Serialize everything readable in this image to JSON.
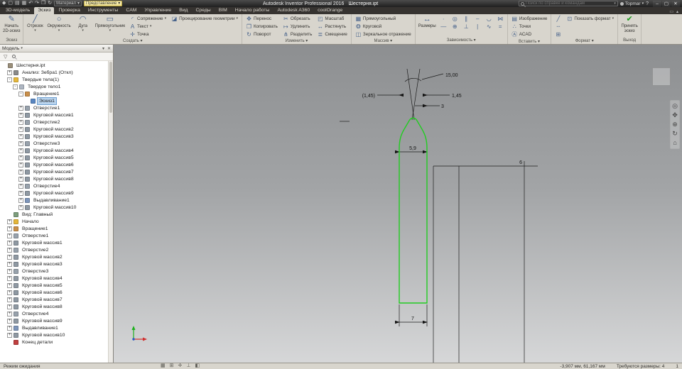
{
  "titlebar": {
    "app_title": "Autodesk Inventor Professional 2016",
    "doc_title": "Шестерня.ipt",
    "search_placeholder": "Поиск по справке и командам",
    "user": "Topmar",
    "material_combo": "Материал",
    "appearance_combo": "Представление",
    "help": "?",
    "win_min": "–",
    "win_max": "▢",
    "win_close": "✕",
    "qat": [
      {
        "name": "app-menu",
        "glyph": "◆"
      },
      {
        "name": "new-file",
        "glyph": "▢"
      },
      {
        "name": "open-file",
        "glyph": "▤"
      },
      {
        "name": "save",
        "glyph": "▦"
      },
      {
        "name": "undo",
        "glyph": "↶"
      },
      {
        "name": "redo",
        "glyph": "↷"
      },
      {
        "name": "print",
        "glyph": "❒"
      },
      {
        "name": "update",
        "glyph": "↻"
      }
    ]
  },
  "tabs": {
    "items": [
      "3D-модель",
      "Эскиз",
      "Проверка",
      "Инструменты",
      "CAM",
      "Управление",
      "Вид",
      "Среды",
      "BIM",
      "Начало работы",
      "Autodesk A360",
      "coolOrange"
    ],
    "active": "Эскиз",
    "right_icons": [
      {
        "name": "ribbon-display-toggle",
        "glyph": "▭"
      },
      {
        "name": "ribbon-collapse",
        "glyph": "▴"
      }
    ]
  },
  "ribbon": {
    "groups": [
      {
        "label": "Эскиз",
        "big": [
          {
            "name": "start-2d-sketch",
            "glyph": "✎",
            "label": "Начать\n2D-эскиз"
          }
        ]
      },
      {
        "label": "Создать",
        "menu_arrow": true,
        "big": [
          {
            "name": "line",
            "glyph": "╱",
            "label": "Отрезок",
            "dd": true
          },
          {
            "name": "circle",
            "glyph": "○",
            "label": "Окружность",
            "dd": true
          },
          {
            "name": "arc",
            "glyph": "◠",
            "label": "Дуга",
            "dd": true
          },
          {
            "name": "rectangle",
            "glyph": "▭",
            "label": "Прямоугольник",
            "dd": true
          }
        ],
        "cols": [
          [
            {
              "name": "fillet",
              "glyph": "◜",
              "label": "Сопряжение",
              "dd": true
            },
            {
              "name": "text",
              "glyph": "A",
              "label": "Текст",
              "dd": true
            },
            {
              "name": "point",
              "glyph": "✛",
              "label": "Точка"
            }
          ],
          [
            {
              "name": "project-geometry",
              "glyph": "◪",
              "label": "Проецирование геометрии",
              "dd": true
            }
          ]
        ]
      },
      {
        "label": "Изменить",
        "menu_arrow": true,
        "cols": [
          [
            {
              "name": "move",
              "glyph": "✥",
              "label": "Перенос"
            },
            {
              "name": "copy",
              "glyph": "❐",
              "label": "Копировать"
            },
            {
              "name": "rotate",
              "glyph": "↻",
              "label": "Поворот"
            }
          ],
          [
            {
              "name": "trim",
              "glyph": "✂",
              "label": "Обрезать"
            },
            {
              "name": "extend",
              "glyph": "↦",
              "label": "Удлинить"
            },
            {
              "name": "split",
              "glyph": "⋔",
              "label": "Разделить"
            }
          ],
          [
            {
              "name": "scale",
              "glyph": "◰",
              "label": "Масштаб"
            },
            {
              "name": "stretch",
              "glyph": "↔",
              "label": "Растянуть"
            },
            {
              "name": "offset",
              "glyph": "≣",
              "label": "Смещение"
            }
          ]
        ]
      },
      {
        "label": "Массив",
        "menu_arrow": true,
        "cols": [
          [
            {
              "name": "rectangular-pattern",
              "glyph": "▦",
              "label": "Прямоугольный"
            },
            {
              "name": "circular-pattern",
              "glyph": "❂",
              "label": "Круговой"
            },
            {
              "name": "mirror",
              "glyph": "◫",
              "label": "Зеркальное отражение"
            }
          ]
        ]
      },
      {
        "label": "Зависимость",
        "menu_arrow": true,
        "big": [
          {
            "name": "dimension",
            "glyph": "↔",
            "label": "Размеры"
          }
        ],
        "cols": [
          [
            {
              "name": "constraint-coincident",
              "glyph": "∙",
              "label": ""
            },
            {
              "name": "constraint-collinear",
              "glyph": "—",
              "label": ""
            }
          ],
          [
            {
              "name": "constraint-concentric",
              "glyph": "◎",
              "label": ""
            },
            {
              "name": "constraint-fix",
              "glyph": "⊕",
              "label": ""
            }
          ],
          [
            {
              "name": "constraint-parallel",
              "glyph": "∥",
              "label": ""
            },
            {
              "name": "constraint-perpendicular",
              "glyph": "⊥",
              "label": ""
            }
          ],
          [
            {
              "name": "constraint-horizontal",
              "glyph": "–",
              "label": ""
            },
            {
              "name": "constraint-vertical",
              "glyph": "|",
              "label": ""
            }
          ],
          [
            {
              "name": "constraint-tangent",
              "glyph": "◡",
              "label": ""
            },
            {
              "name": "constraint-smooth",
              "glyph": "∿",
              "label": ""
            }
          ],
          [
            {
              "name": "constraint-symmetric",
              "glyph": "⋈",
              "label": ""
            },
            {
              "name": "constraint-equal",
              "glyph": "=",
              "label": ""
            }
          ]
        ]
      },
      {
        "label": "Вставить",
        "menu_arrow": true,
        "cols": [
          [
            {
              "name": "insert-image",
              "glyph": "▤",
              "label": "Изображение"
            },
            {
              "name": "import-points",
              "glyph": "∴",
              "label": "Точки"
            },
            {
              "name": "import-acad",
              "glyph": "Ⓐ",
              "label": "ACAD"
            }
          ]
        ]
      },
      {
        "label": "Формат",
        "menu_arrow": true,
        "cols": [
          [
            {
              "name": "construction-geometry",
              "glyph": "╱",
              "label": ""
            },
            {
              "name": "centerline",
              "glyph": "┄",
              "label": ""
            },
            {
              "name": "driven-dimension",
              "glyph": "⊞",
              "label": ""
            }
          ],
          [
            {
              "name": "show-format",
              "glyph": "⊡",
              "label": "Показать формат",
              "dd": true
            }
          ]
        ]
      },
      {
        "label": "Выход",
        "big": [
          {
            "name": "finish-sketch",
            "glyph": "✔",
            "label": "Принять\nэскиз",
            "color": "#1e9e1e"
          }
        ]
      }
    ]
  },
  "browser": {
    "title": "Модель",
    "header_icons": [
      {
        "name": "browser-menu-arrow",
        "glyph": "▾"
      },
      {
        "name": "browser-close",
        "glyph": "✕"
      }
    ],
    "filter_icon": "▽",
    "icon_colors": {
      "doc": "#9a8f7a",
      "analysis": "#8a8a8a",
      "folder": "#e5b73b",
      "solid": "#aeb6c2",
      "revolve": "#c98f4a",
      "sketch": "#5a87c2",
      "hole": "#98a2ac",
      "pattern": "#8f99a3",
      "extrude": "#7d95ba",
      "view": "#7d9e7d",
      "origin": "#e5b73b",
      "eom": "#c04040"
    },
    "tree": [
      {
        "t": "Шестерня.ipt",
        "i": 0,
        "k": "doc",
        "x": ""
      },
      {
        "t": "Анализ: Зебра1 (Откл)",
        "i": 1,
        "k": "analysis",
        "x": "+"
      },
      {
        "t": "Твердые тела(1)",
        "i": 1,
        "k": "folder",
        "x": "-"
      },
      {
        "t": "Твердое тело1",
        "i": 2,
        "k": "solid",
        "x": "-"
      },
      {
        "t": "Вращение1",
        "i": 3,
        "k": "revolve",
        "x": "-"
      },
      {
        "t": "Эскиз1",
        "i": 4,
        "k": "sketch",
        "x": "",
        "sel": true
      },
      {
        "t": "Отверстие1",
        "i": 3,
        "k": "hole",
        "x": "+"
      },
      {
        "t": "Круговой массив1",
        "i": 3,
        "k": "pattern",
        "x": "+"
      },
      {
        "t": "Отверстие2",
        "i": 3,
        "k": "hole",
        "x": "+"
      },
      {
        "t": "Круговой массив2",
        "i": 3,
        "k": "pattern",
        "x": "+"
      },
      {
        "t": "Круговой массив3",
        "i": 3,
        "k": "pattern",
        "x": "+"
      },
      {
        "t": "Отверстие3",
        "i": 3,
        "k": "hole",
        "x": "+"
      },
      {
        "t": "Круговой массив4",
        "i": 3,
        "k": "pattern",
        "x": "+"
      },
      {
        "t": "Круговой массив5",
        "i": 3,
        "k": "pattern",
        "x": "+"
      },
      {
        "t": "Круговой массив6",
        "i": 3,
        "k": "pattern",
        "x": "+"
      },
      {
        "t": "Круговой массив7",
        "i": 3,
        "k": "pattern",
        "x": "+"
      },
      {
        "t": "Круговой массив8",
        "i": 3,
        "k": "pattern",
        "x": "+"
      },
      {
        "t": "Отверстие4",
        "i": 3,
        "k": "hole",
        "x": "+"
      },
      {
        "t": "Круговой массив9",
        "i": 3,
        "k": "pattern",
        "x": "+"
      },
      {
        "t": "Выдавливание1",
        "i": 3,
        "k": "extrude",
        "x": "+"
      },
      {
        "t": "Круговой массив10",
        "i": 3,
        "k": "pattern",
        "x": "+"
      },
      {
        "t": "Вид: Главный",
        "i": 1,
        "k": "view",
        "x": ""
      },
      {
        "t": "Начало",
        "i": 1,
        "k": "origin",
        "x": "+"
      },
      {
        "t": "Вращение1",
        "i": 1,
        "k": "revolve",
        "x": "+"
      },
      {
        "t": "Отверстие1",
        "i": 1,
        "k": "hole",
        "x": "+"
      },
      {
        "t": "Круговой массив1",
        "i": 1,
        "k": "pattern",
        "x": "+"
      },
      {
        "t": "Отверстие2",
        "i": 1,
        "k": "hole",
        "x": "+"
      },
      {
        "t": "Круговой массив2",
        "i": 1,
        "k": "pattern",
        "x": "+"
      },
      {
        "t": "Круговой массив3",
        "i": 1,
        "k": "pattern",
        "x": "+"
      },
      {
        "t": "Отверстие3",
        "i": 1,
        "k": "hole",
        "x": "+"
      },
      {
        "t": "Круговой массив4",
        "i": 1,
        "k": "pattern",
        "x": "+"
      },
      {
        "t": "Круговой массив5",
        "i": 1,
        "k": "pattern",
        "x": "+"
      },
      {
        "t": "Круговой массив6",
        "i": 1,
        "k": "pattern",
        "x": "+"
      },
      {
        "t": "Круговой массив7",
        "i": 1,
        "k": "pattern",
        "x": "+"
      },
      {
        "t": "Круговой массив8",
        "i": 1,
        "k": "pattern",
        "x": "+"
      },
      {
        "t": "Отверстие4",
        "i": 1,
        "k": "hole",
        "x": "+"
      },
      {
        "t": "Круговой массив9",
        "i": 1,
        "k": "pattern",
        "x": "+"
      },
      {
        "t": "Выдавливание1",
        "i": 1,
        "k": "extrude",
        "x": "+"
      },
      {
        "t": "Круговой массив10",
        "i": 1,
        "k": "pattern",
        "x": "+"
      },
      {
        "t": "Конец детали",
        "i": 1,
        "k": "eom",
        "x": ""
      }
    ]
  },
  "viewport": {
    "dims": {
      "angle": "15,00",
      "right": "1,45",
      "left": "(1,45)",
      "three": "3",
      "width": "5,9",
      "bottom": "7",
      "six": "6"
    },
    "sketch_color": "#22cc22",
    "navbar_icons": [
      {
        "name": "navigation-wheel-icon",
        "glyph": "◎"
      },
      {
        "name": "pan-icon",
        "glyph": "✥"
      },
      {
        "name": "zoom-icon",
        "glyph": "⊕"
      },
      {
        "name": "orbit-icon",
        "glyph": "↻"
      },
      {
        "name": "look-at-icon",
        "glyph": "⌂"
      }
    ]
  },
  "statusbar": {
    "mode": "Режим ожидания",
    "icons": [
      {
        "name": "snap-grid-icon",
        "glyph": "▦"
      },
      {
        "name": "grid-lines-icon",
        "glyph": "⊞"
      },
      {
        "name": "axes-icon",
        "glyph": "✛"
      },
      {
        "name": "ortho-icon",
        "glyph": "⊥"
      },
      {
        "name": "precise-input-icon",
        "glyph": "◧"
      }
    ],
    "coords": "-3,907 мм, 61,167 мм",
    "required": "Требуются размеры: 4",
    "page": "1"
  }
}
